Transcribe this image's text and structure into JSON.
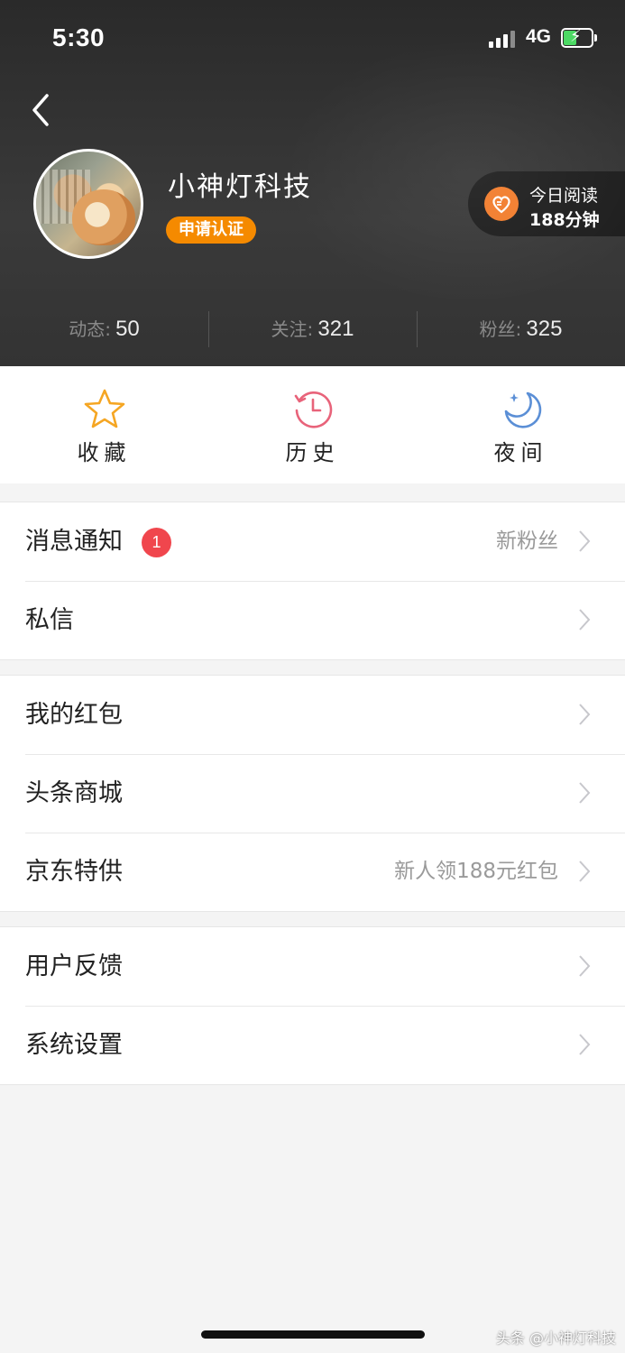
{
  "status_bar": {
    "time": "5:30",
    "network": "4G"
  },
  "profile": {
    "name": "小神灯科技",
    "verify_label": "申请认证",
    "reading": {
      "line1": "今日阅读",
      "line2": "188分钟"
    }
  },
  "stats": [
    {
      "label": "动态:",
      "value": "50"
    },
    {
      "label": "关注:",
      "value": "321"
    },
    {
      "label": "粉丝:",
      "value": "325"
    }
  ],
  "quick_actions": [
    {
      "label": "收藏",
      "icon": "star-icon",
      "color": "#f5a623"
    },
    {
      "label": "历史",
      "icon": "history-clock-icon",
      "color": "#e8637a"
    },
    {
      "label": "夜间",
      "icon": "moon-icon",
      "color": "#5b8fd6"
    }
  ],
  "menu_groups": [
    [
      {
        "title": "消息通知",
        "badge": "1",
        "subtitle": "新粉丝"
      },
      {
        "title": "私信",
        "subtitle": ""
      }
    ],
    [
      {
        "title": "我的红包",
        "subtitle": ""
      },
      {
        "title": "头条商城",
        "subtitle": ""
      },
      {
        "title": "京东特供",
        "subtitle": "新人领188元红包"
      }
    ],
    [
      {
        "title": "用户反馈",
        "subtitle": ""
      },
      {
        "title": "系统设置",
        "subtitle": ""
      }
    ]
  ],
  "watermark": "头条 @小神灯科技",
  "colors": {
    "accent_orange": "#f58a00",
    "badge_red": "#f0464d"
  }
}
